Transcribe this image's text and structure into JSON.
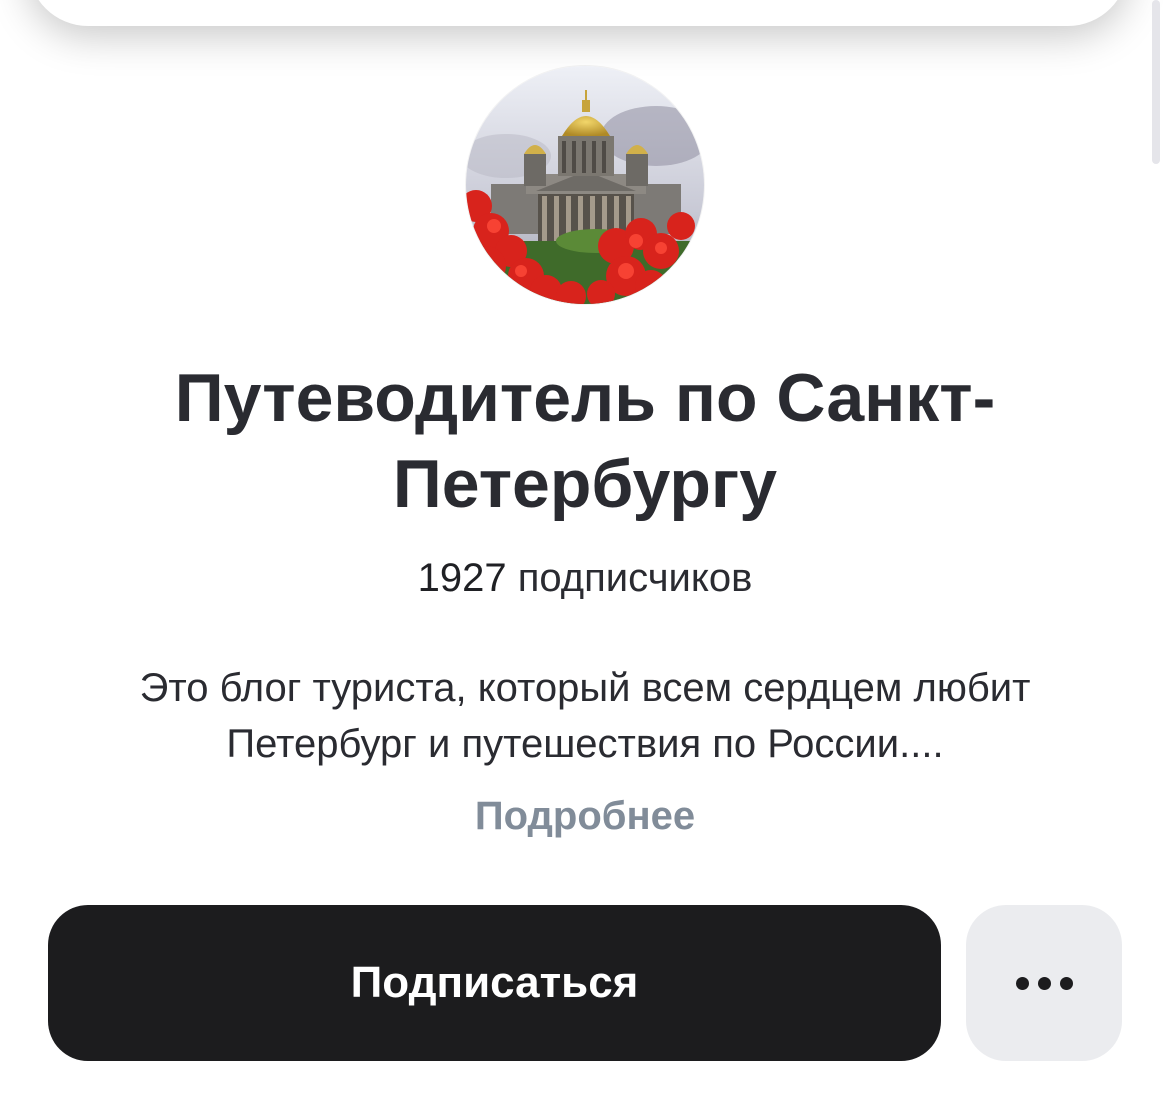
{
  "header": {
    "title": "Путеводитель по Санкт-Петербургу",
    "avatar_description": "isaac-cathedral-photo"
  },
  "stats": {
    "subscribers_count": "1927",
    "subscribers_label": "подписчиков"
  },
  "description": {
    "text": "Это блог туриста, который всем сердцем любит Петербург и путешествия по России....",
    "more_link": "Подробнее"
  },
  "actions": {
    "subscribe_label": "Подписаться",
    "more_icon": "ellipsis-icon"
  },
  "colors": {
    "primary_button": "#1c1c1e",
    "secondary_button": "#ebecef",
    "link_gray": "#818c99",
    "text": "#2a2b31"
  }
}
